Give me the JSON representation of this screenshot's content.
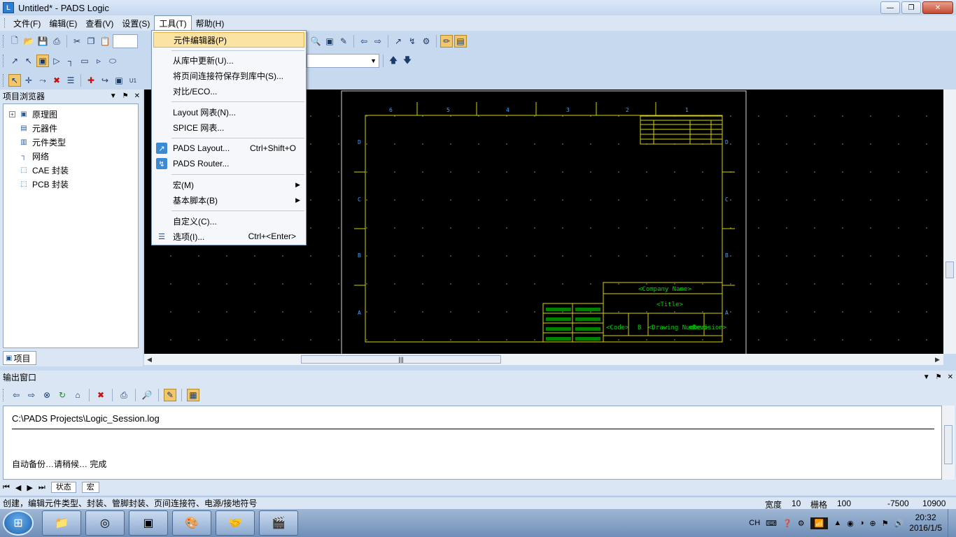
{
  "window": {
    "title": "Untitled* - PADS Logic",
    "app_icon": "pads-logic-icon"
  },
  "menubar": [
    "文件(F)",
    "编辑(E)",
    "查看(V)",
    "设置(S)",
    "工具(T)",
    "帮助(H)"
  ],
  "tools_menu": {
    "items": [
      {
        "label": "元件编辑器(P)",
        "shortcut": "",
        "submenu": false,
        "icon": ""
      },
      {
        "label": "从库中更新(U)...",
        "shortcut": "",
        "submenu": false,
        "icon": ""
      },
      {
        "label": "将页间连接符保存到库中(S)...",
        "shortcut": "",
        "submenu": false,
        "icon": ""
      },
      {
        "label": "对比/ECO...",
        "shortcut": "",
        "submenu": false,
        "icon": ""
      },
      {
        "label": "Layout 网表(N)...",
        "shortcut": "",
        "submenu": false,
        "icon": ""
      },
      {
        "label": "SPICE 网表...",
        "shortcut": "",
        "submenu": false,
        "icon": ""
      },
      {
        "label": "PADS Layout...",
        "shortcut": "Ctrl+Shift+O",
        "submenu": false,
        "icon": "pads-layout-icon"
      },
      {
        "label": "PADS Router...",
        "shortcut": "",
        "submenu": false,
        "icon": "pads-router-icon"
      },
      {
        "label": "宏(M)",
        "shortcut": "",
        "submenu": true,
        "icon": ""
      },
      {
        "label": "基本脚本(B)",
        "shortcut": "",
        "submenu": true,
        "icon": ""
      },
      {
        "label": "自定义(C)...",
        "shortcut": "",
        "submenu": false,
        "icon": ""
      },
      {
        "label": "选项(I)...",
        "shortcut": "Ctrl+<Enter>",
        "submenu": false,
        "icon": "options-icon"
      }
    ]
  },
  "project_browser": {
    "title": "项目浏览器",
    "items": [
      "原理图",
      "元器件",
      "元件类型",
      "网络",
      "CAE 封装",
      "PCB 封装"
    ],
    "tab": "项目"
  },
  "sheet": {
    "col_labels": [
      "6",
      "5",
      "4",
      "3",
      "2",
      "1"
    ],
    "row_labels": [
      "D",
      "C",
      "B",
      "A"
    ],
    "company": "<Company Name>",
    "title": "<Title>",
    "code": "<Code>",
    "size": "B",
    "drawing": "<Drawing Number>",
    "revision": "<Revision>"
  },
  "output": {
    "title": "输出窗口",
    "log_path": "C:\\PADS Projects\\Logic_Session.log",
    "message": "自动备份…请稍候…  完成",
    "tabs": [
      "状态",
      "宏"
    ]
  },
  "statusbar": {
    "message": "创建，编辑元件类型、封装、管脚封装、页间连接符、电源/接地符号",
    "width_label": "宽度",
    "width_value": "10",
    "grid_label": "栅格",
    "grid_value": "100",
    "x": "-7500",
    "y": "10900"
  },
  "taskbar": {
    "lang": "CH",
    "time": "20:32",
    "date": "2016/1/5"
  },
  "colors": {
    "canvas": "#000000",
    "sheet_border": "#e0e000",
    "sheet_text": "#00d000",
    "accent": "#3a8ad4"
  }
}
